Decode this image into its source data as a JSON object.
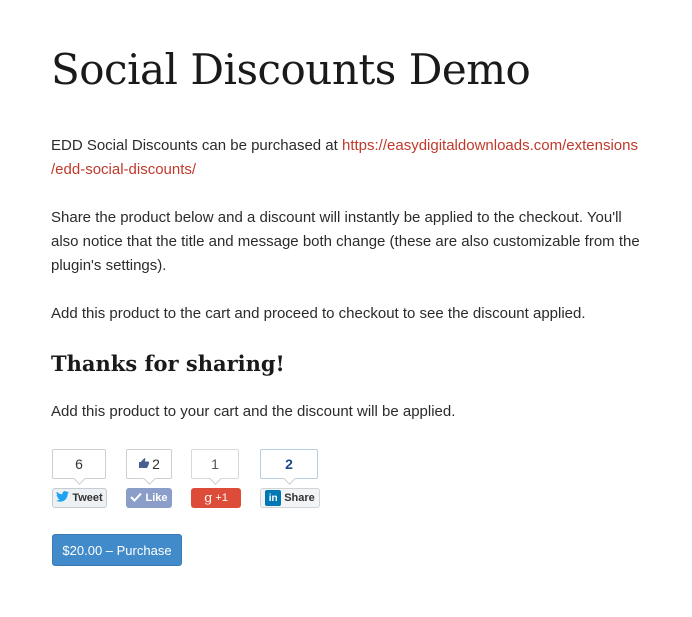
{
  "page": {
    "title": "Social Discounts Demo",
    "intro_text": "EDD Social Discounts can be purchased at ",
    "intro_link_line1": "https://easydigitaldownloads.com/extensions",
    "intro_link_line2": "/edd-social-discounts/",
    "share_text": "Share the product below and a discount will instantly be applied to the checkout. You'll also notice that the title and message both change (these are also customizable from the plugin's settings).",
    "cart_text": "Add this product to the cart and proceed to checkout to see the discount applied.",
    "thanks_heading": "Thanks for sharing!",
    "thanks_text": "Add this product to your cart and the discount will be applied."
  },
  "share_buttons": {
    "twitter": {
      "count": "6",
      "label": "Tweet"
    },
    "facebook": {
      "count": "2",
      "label": "Like"
    },
    "googleplus": {
      "count": "1",
      "label": "+1"
    },
    "linkedin": {
      "count": "2",
      "label": "Share",
      "logo": "in"
    }
  },
  "purchase": {
    "label": "$20.00 – Purchase"
  },
  "colors": {
    "link": "#c0392b",
    "button": "#428bca",
    "facebook": "#8b9dc9",
    "googleplus": "#dd4b39",
    "linkedin": "#0077b5"
  },
  "icons": [
    "twitter-bird-icon",
    "thumbs-up-icon",
    "checkmark-icon",
    "google-g-icon",
    "linkedin-logo-icon"
  ]
}
